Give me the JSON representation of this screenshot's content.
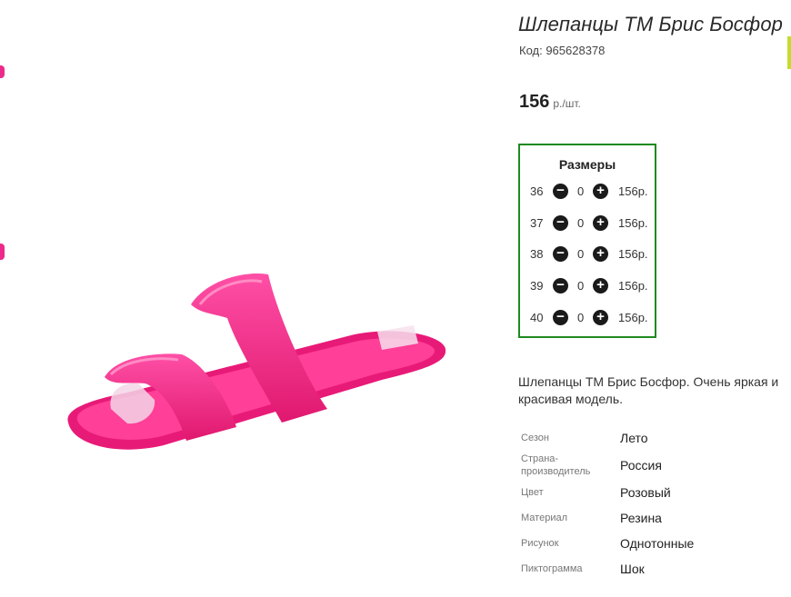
{
  "product": {
    "title": "Шлепанцы ТМ Брис Босфор",
    "code": "Код: 965628378",
    "price": "156",
    "price_unit": "р./шт.",
    "description": "Шлепанцы ТМ Брис Босфор. Очень яркая и красивая модель.",
    "color": "#f0287f"
  },
  "sizes": {
    "heading": "Размеры",
    "rows": [
      {
        "size": "36",
        "qty": "0",
        "price": "156р."
      },
      {
        "size": "37",
        "qty": "0",
        "price": "156р."
      },
      {
        "size": "38",
        "qty": "0",
        "price": "156р."
      },
      {
        "size": "39",
        "qty": "0",
        "price": "156р."
      },
      {
        "size": "40",
        "qty": "0",
        "price": "156р."
      }
    ]
  },
  "properties": [
    {
      "key": "Сезон",
      "value": "Лето"
    },
    {
      "key": "Страна-производитель",
      "key_line1": "Страна-",
      "key_line2": "производитель",
      "value": "Россия"
    },
    {
      "key": "Цвет",
      "value": "Розовый"
    },
    {
      "key": "Материал",
      "value": "Резина"
    },
    {
      "key": "Рисунок",
      "value": "Однотонные"
    },
    {
      "key": "Пиктограмма",
      "value": "Шок"
    }
  ]
}
